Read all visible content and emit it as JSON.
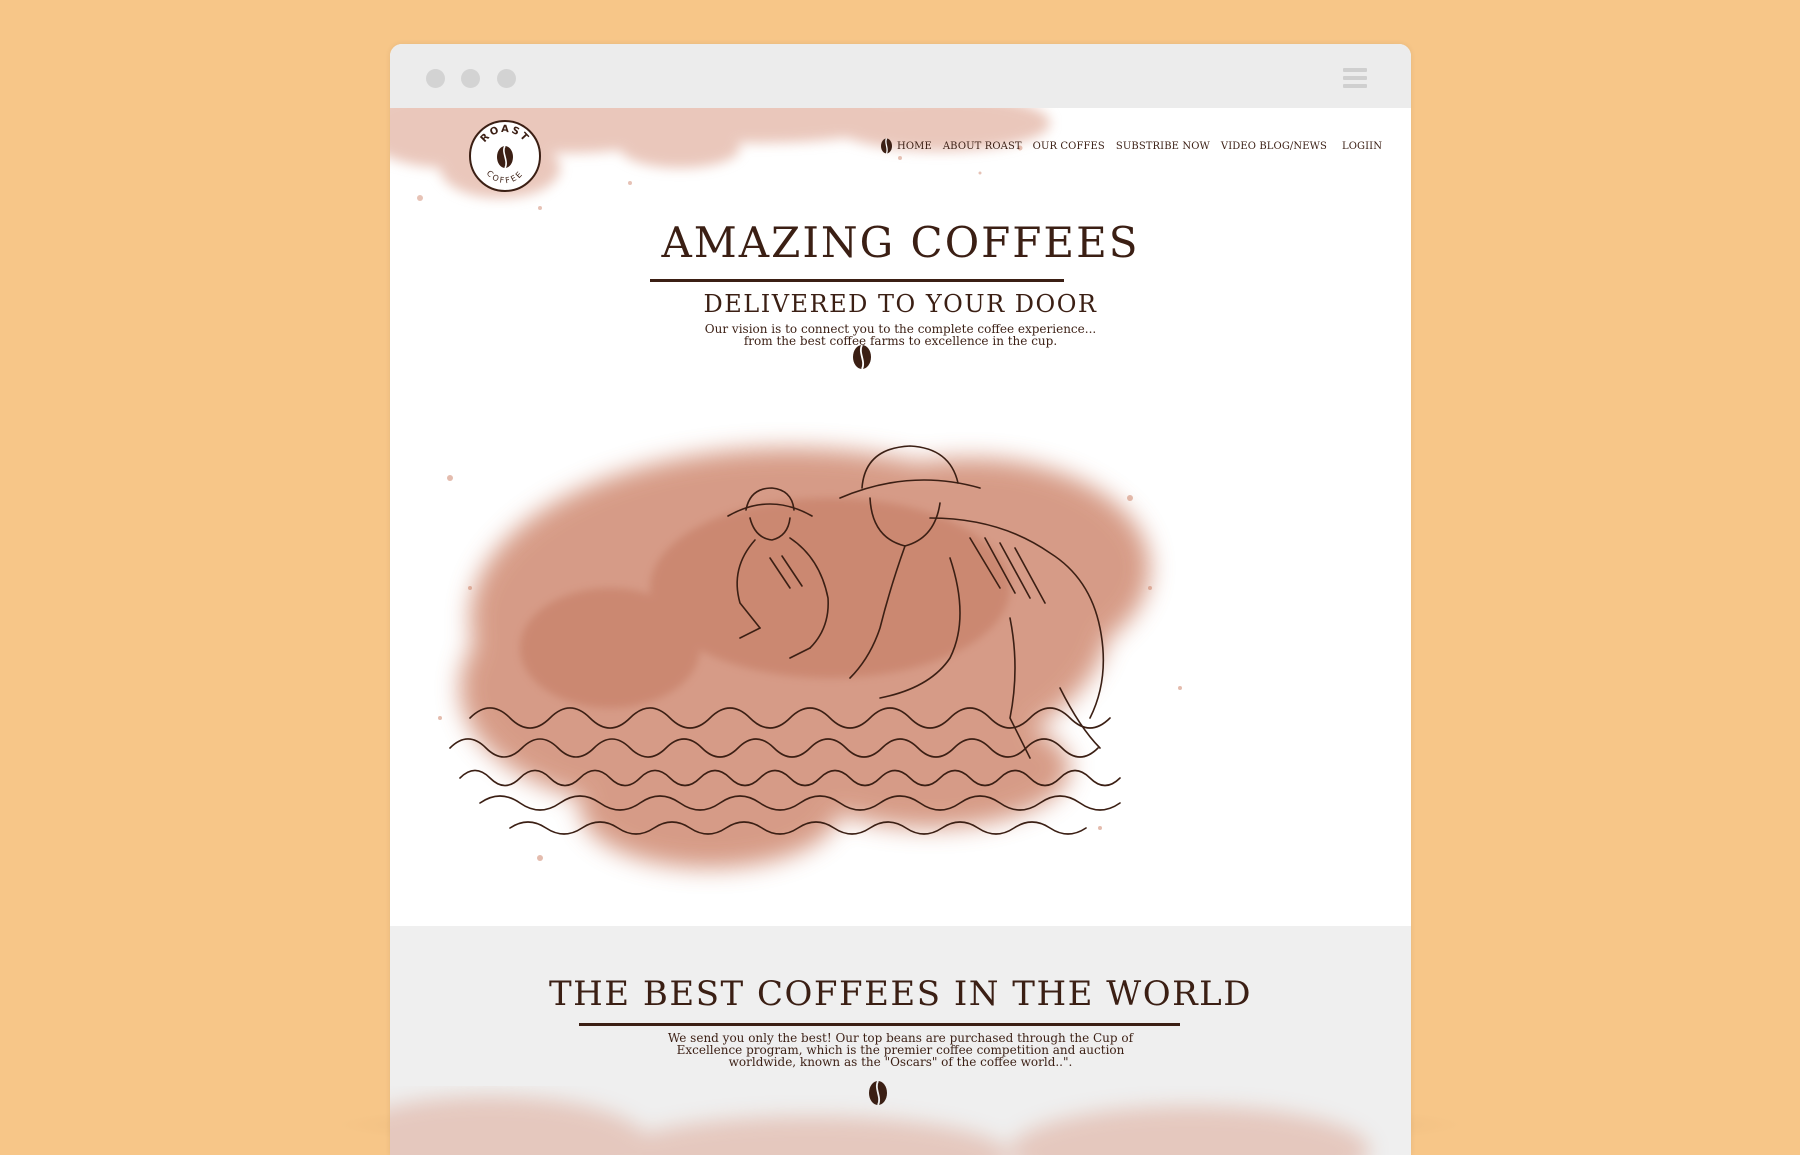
{
  "brand": {
    "logo_top": "ROAST",
    "logo_bottom": "COFFEE"
  },
  "nav": {
    "items": [
      {
        "label": "HOME",
        "icon": "coffee-bean-icon"
      },
      {
        "label": "ABOUT ROAST"
      },
      {
        "label": "OUR COFFES"
      },
      {
        "label": "SUBSTRIBE NOW"
      },
      {
        "label": "VIDEO BLOG/NEWS"
      },
      {
        "label": "LOGIIN"
      }
    ]
  },
  "hero": {
    "headline": "AMAZING COFFEES",
    "subheadline": "DELIVERED TO YOUR DOOR",
    "vision_line1": "Our vision is to connect you to the complete coffee experience...",
    "vision_line2": "from the best coffee farms to excellence in the cup."
  },
  "section2": {
    "headline": "THE BEST COFFEES IN THE WORLD",
    "body_line1": "We send you only the best! Our top beans are purchased through the Cup of",
    "body_line2": "Excellence program, which is the premier coffee competition and auction",
    "body_line3": "worldwide, known as the \"Oscars\" of the coffee world..\"."
  },
  "colors": {
    "background": "#f7c688",
    "text_brown": "#3b1f14",
    "watercolor": "#c97a5e",
    "section_gray": "#efefef"
  }
}
